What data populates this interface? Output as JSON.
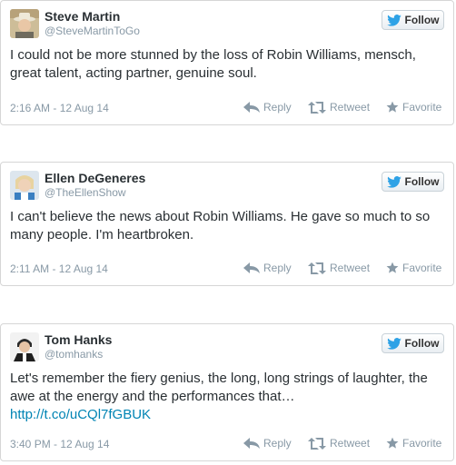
{
  "tweets": [
    {
      "name": "Steve Martin",
      "handle": "@SteveMartinToGo",
      "text": "I could not be more stunned by the loss of Robin Williams, mensch, great talent, acting partner, genuine soul.",
      "link": "",
      "timestamp": "2:16 AM - 12 Aug 14",
      "avatar_icon": "steve-martin-avatar"
    },
    {
      "name": "Ellen DeGeneres",
      "handle": "@TheEllenShow",
      "text": "I can't believe the news about Robin Williams. He gave so much to so many people. I'm heartbroken.",
      "link": "",
      "timestamp": "2:11 AM - 12 Aug 14",
      "avatar_icon": "ellen-degeneres-avatar"
    },
    {
      "name": "Tom Hanks",
      "handle": "@tomhanks",
      "text": "Let's remember the fiery genius, the long, long strings of laughter, the awe at the energy and the performances that…",
      "link": "http://t.co/uCQl7fGBUK",
      "timestamp": "3:40 PM - 12 Aug 14",
      "avatar_icon": "tom-hanks-avatar"
    }
  ],
  "labels": {
    "follow": "Follow",
    "reply": "Reply",
    "retweet": "Retweet",
    "favorite": "Favorite"
  },
  "colors": {
    "twitter_blue": "#2ea2e6",
    "link": "#0084b4",
    "muted": "#8899a6"
  }
}
